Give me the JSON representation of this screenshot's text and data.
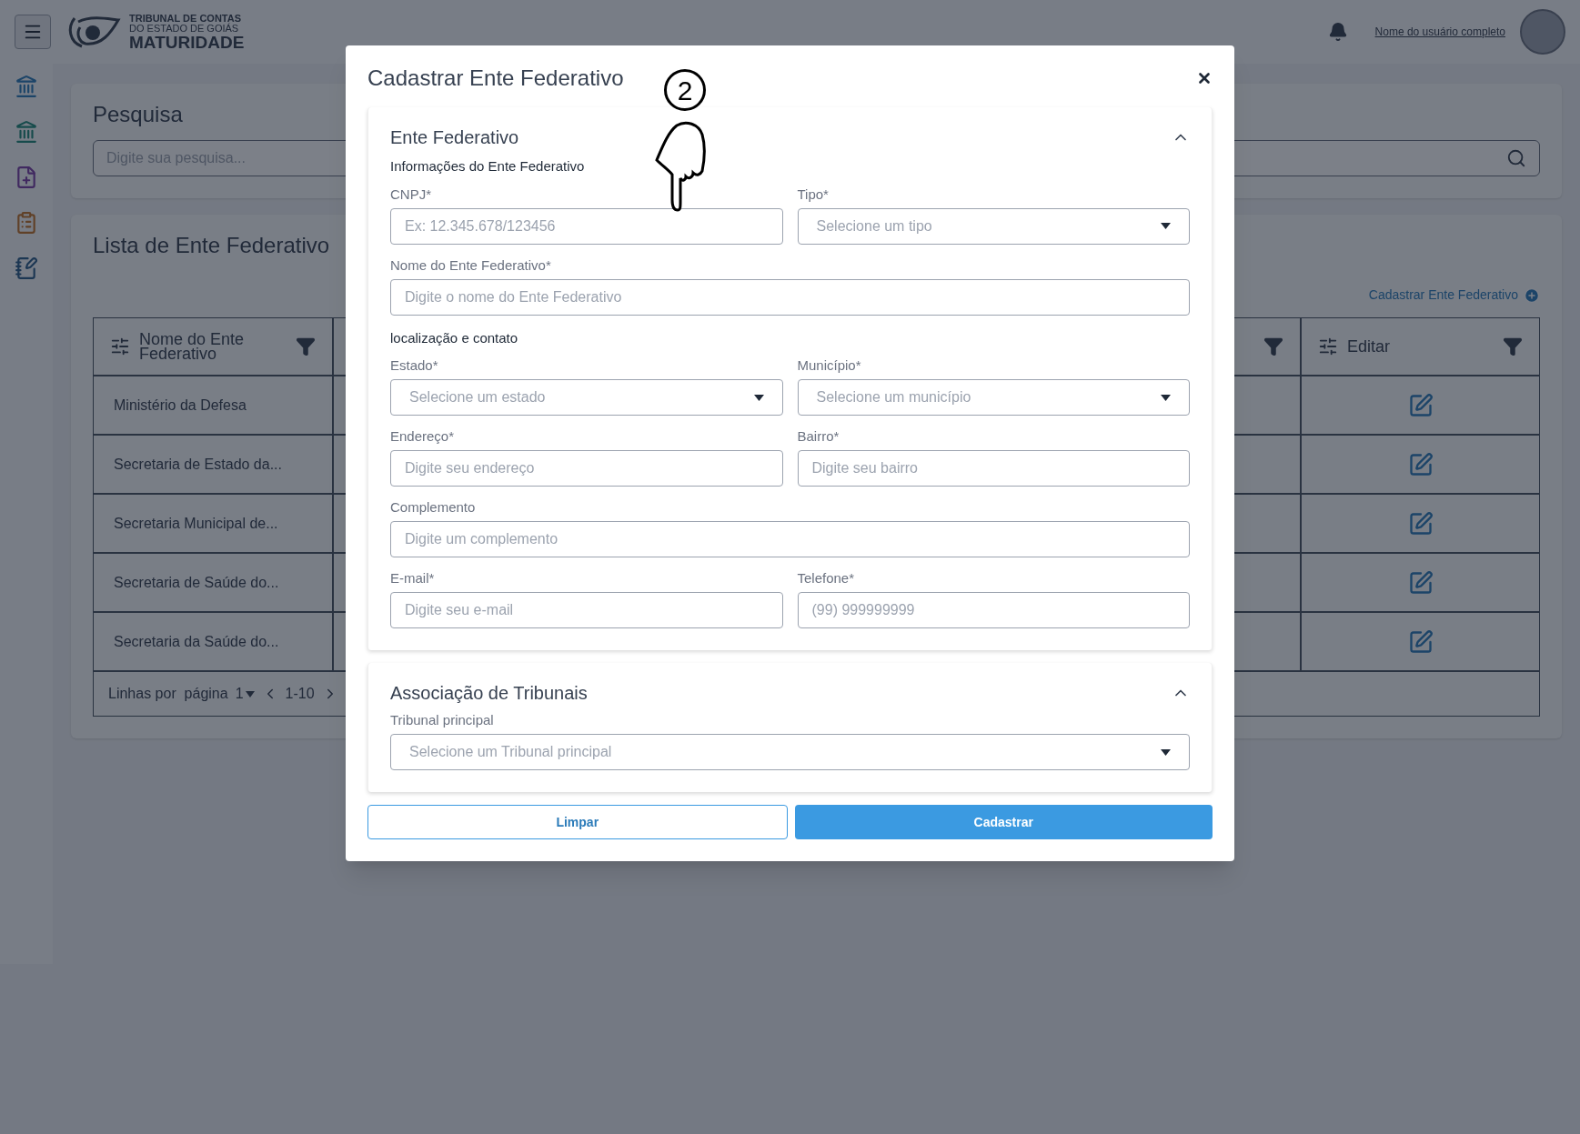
{
  "header": {
    "logo_line_1": "TRIBUNAL DE CONTAS",
    "logo_line_2": "DO ESTADO DE GOIÁS",
    "logo_line_3": "MATURIDADE",
    "user_name": "Nome do usuário completo"
  },
  "search": {
    "title": "Pesquisa",
    "placeholder": "Digite sua pesquisa..."
  },
  "list": {
    "title": "Lista de Ente Federativo",
    "add_link": "Cadastrar Ente Federativo",
    "columns": [
      {
        "label": "Nome do Ente Federativo"
      },
      {
        "label": "Editar"
      }
    ],
    "rows": [
      {
        "name": "Ministério da Defesa"
      },
      {
        "name": "Secretaria de Estado da..."
      },
      {
        "name": "Secretaria Municipal de..."
      },
      {
        "name": "Secretaria de Saúde do..."
      },
      {
        "name": "Secretaria da Saúde do..."
      }
    ],
    "pagination": {
      "rows_label": "Linhas por  página",
      "per_page": "1",
      "range": "1-10"
    }
  },
  "modal": {
    "title": "Cadastrar Ente Federativo",
    "sections": [
      {
        "title": "Ente Federativo",
        "expanded": true,
        "rows": [
          {
            "kind": "heading",
            "text": "Informações do Ente Federativo"
          },
          {
            "kind": "fields",
            "fields": [
              {
                "kind": "input",
                "label": "CNPJ*",
                "placeholder": "Ex: 12.345.678/123456"
              },
              {
                "kind": "select",
                "label": "Tipo*",
                "placeholder": "Selecione um tipo"
              }
            ]
          },
          {
            "kind": "fields",
            "fields": [
              {
                "kind": "input",
                "label": "Nome do Ente Federativo*",
                "placeholder": "Digite o nome do Ente Federativo"
              }
            ]
          },
          {
            "kind": "heading",
            "text": "localização e contato"
          },
          {
            "kind": "fields",
            "fields": [
              {
                "kind": "select",
                "label": "Estado*",
                "placeholder": "Selecione um estado"
              },
              {
                "kind": "select",
                "label": "Município*",
                "placeholder": "Selecione um município"
              }
            ]
          },
          {
            "kind": "fields",
            "fields": [
              {
                "kind": "input",
                "label": "Endereço*",
                "placeholder": "Digite seu endereço"
              },
              {
                "kind": "input",
                "label": "Bairro*",
                "placeholder": "Digite seu bairro"
              }
            ]
          },
          {
            "kind": "fields",
            "fields": [
              {
                "kind": "input",
                "label": "Complemento",
                "placeholder": "Digite um complemento"
              }
            ]
          },
          {
            "kind": "fields",
            "fields": [
              {
                "kind": "input",
                "label": "E-mail*",
                "placeholder": "Digite seu e-mail"
              },
              {
                "kind": "input",
                "label": "Telefone*",
                "placeholder": "(99) 999999999"
              }
            ]
          }
        ]
      },
      {
        "title": "Associação de Tribunais",
        "expanded": true,
        "rows": [
          {
            "kind": "fields",
            "fields": [
              {
                "kind": "select",
                "label": "Tribunal principal",
                "placeholder": "Selecione um Tribunal principal"
              }
            ]
          }
        ]
      }
    ],
    "buttons": [
      {
        "kind": "secondary",
        "label": "Limpar"
      },
      {
        "kind": "primary",
        "label": "Cadastrar"
      }
    ]
  },
  "annotation": {
    "step": "2"
  }
}
